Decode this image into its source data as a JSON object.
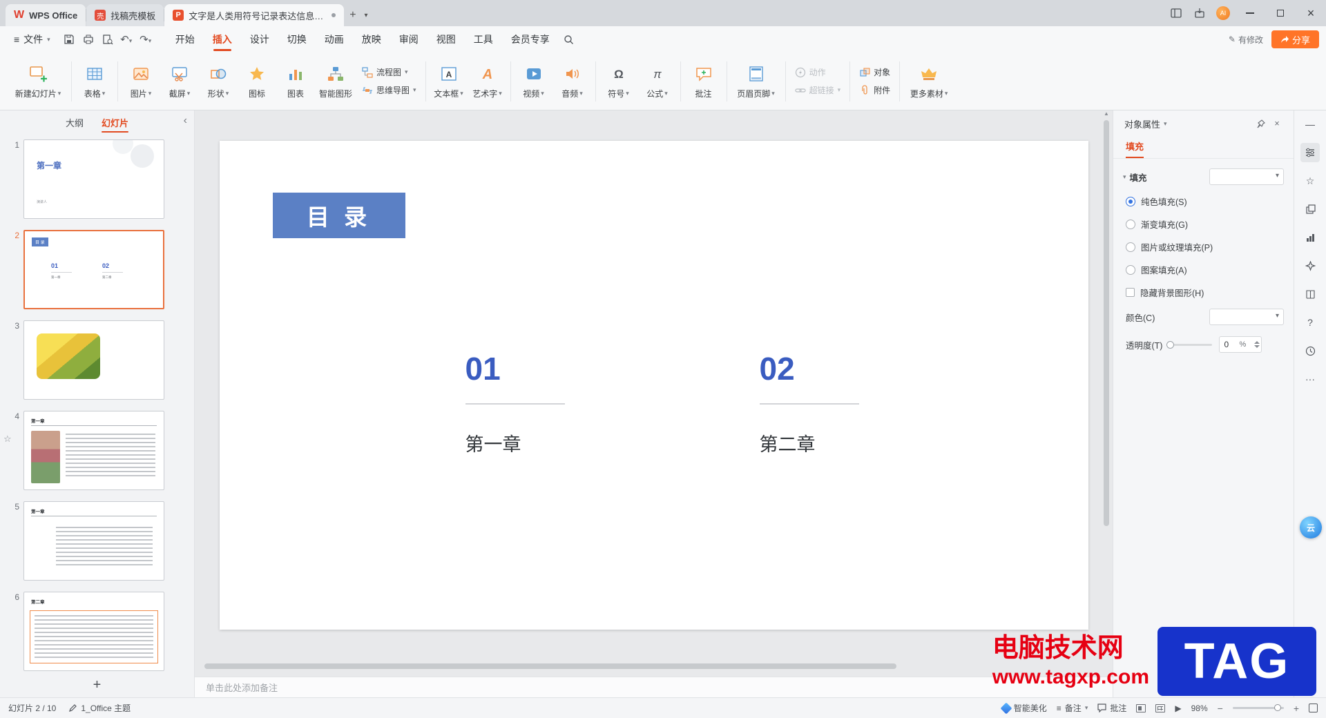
{
  "titlebar": {
    "app_tab": "WPS Office",
    "tab_home": "找稿壳模板",
    "tab_doc": "文字是人类用符号记录表达信息以..."
  },
  "menubar": {
    "file": "文件",
    "tabs": [
      "开始",
      "插入",
      "设计",
      "切换",
      "动画",
      "放映",
      "审阅",
      "视图",
      "工具",
      "会员专享"
    ],
    "modified": "有修改",
    "share": "分享"
  },
  "ribbon": {
    "new_slide": "新建幻灯片",
    "table": "表格",
    "picture": "图片",
    "screenshot": "截屏",
    "shapes": "形状",
    "icon_lib": "图标",
    "chart": "图表",
    "smartart": "智能图形",
    "flowchart": "流程图",
    "mindmap": "思维导图",
    "textbox": "文本框",
    "wordart": "艺术字",
    "video": "视频",
    "audio": "音频",
    "symbol": "符号",
    "formula": "公式",
    "comment": "批注",
    "header_footer": "页眉页脚",
    "action": "动作",
    "hyperlink": "超链接",
    "object": "对象",
    "attachment": "附件",
    "more_assets": "更多素材"
  },
  "sidebar": {
    "tab_outline": "大纲",
    "tab_slides": "幻灯片",
    "add": "+",
    "slides": [
      {
        "num": "1",
        "title": "第一章",
        "sub": "演讲人"
      },
      {
        "num": "2",
        "badge": "目 录",
        "n1": "01",
        "n2": "02",
        "c1": "第一章",
        "c2": "第二章"
      },
      {
        "num": "3"
      },
      {
        "num": "4",
        "title": "第一章"
      },
      {
        "num": "5",
        "title": "第一章"
      },
      {
        "num": "6",
        "title": "第二章"
      }
    ]
  },
  "slide": {
    "title": "目 录",
    "items": [
      {
        "num": "01",
        "label": "第一章"
      },
      {
        "num": "02",
        "label": "第二章"
      }
    ]
  },
  "panel": {
    "title": "对象属性",
    "tab": "填充",
    "section": "填充",
    "fill_options": [
      "纯色填充(S)",
      "渐变填充(G)",
      "图片或纹理填充(P)",
      "图案填充(A)"
    ],
    "hide_bg": "隐藏背景图形(H)",
    "color": "颜色(C)",
    "transparency": "透明度(T)",
    "transparency_value": "0",
    "unit": "%"
  },
  "notes": {
    "placeholder": "单击此处添加备注"
  },
  "statusbar": {
    "slide_info": "幻灯片 2 / 10",
    "theme": "1_Office 主题",
    "beautify": "智能美化",
    "notes_label": "备注",
    "comment": "批注",
    "zoom": "98%"
  },
  "watermark": {
    "line1": "电脑技术网",
    "line2": "www.tagxp.com",
    "badge": "TAG"
  }
}
